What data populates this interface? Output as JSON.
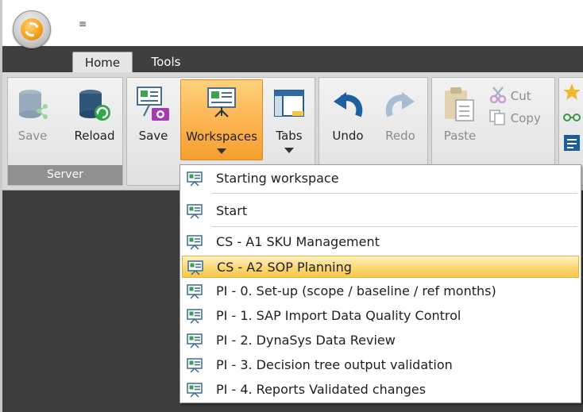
{
  "tabs": [
    {
      "label": "Home",
      "active": true
    },
    {
      "label": "Tools",
      "active": false
    }
  ],
  "ribbon": {
    "server": {
      "label": "Server",
      "save_label": "Save",
      "reload_label": "Reload"
    },
    "view": {
      "save_label": "Save",
      "workspaces_label": "Workspaces",
      "tabs_label": "Tabs"
    },
    "edit": {
      "undo_label": "Undo",
      "redo_label": "Redo"
    },
    "clipboard": {
      "paste_label": "Paste",
      "cut_label": "Cut",
      "copy_label": "Copy"
    }
  },
  "workspace_menu": {
    "items": [
      {
        "label": "Starting workspace",
        "highlighted": false
      },
      {
        "label": "Start",
        "highlighted": false
      },
      {
        "label": "CS - A1 SKU Management",
        "highlighted": false
      },
      {
        "label": "CS - A2 SOP Planning",
        "highlighted": true
      },
      {
        "label": "PI - 0. Set-up (scope / baseline / ref months)",
        "highlighted": false
      },
      {
        "label": "PI - 1. SAP Import Data Quality Control",
        "highlighted": false
      },
      {
        "label": "PI - 2. DynaSys Data Review",
        "highlighted": false
      },
      {
        "label": "PI - 3. Decision tree output validation",
        "highlighted": false
      },
      {
        "label": "PI - 4. Reports  Validated changes",
        "highlighted": false
      }
    ]
  },
  "colors": {
    "tab_strip": "#3f3f3f",
    "workspace_bg": "#3c3c3c",
    "active_button": "#fcb553",
    "menu_highlight": "#fbd776",
    "group_label_bg": "#909090"
  },
  "icons": {
    "app_menu": "app-orb-icon",
    "qat": "customize-quick-access-icon",
    "server_save": "database-share-icon",
    "server_reload": "database-refresh-icon",
    "view_save": "presentation-camera-icon",
    "workspaces": "presentation-icon",
    "tabs": "window-tabs-icon",
    "undo": "undo-arrow-icon",
    "redo": "redo-arrow-icon",
    "paste": "clipboard-paste-icon",
    "cut": "scissors-icon",
    "copy": "copy-icon",
    "workspace_item": "presentation-board-icon"
  }
}
